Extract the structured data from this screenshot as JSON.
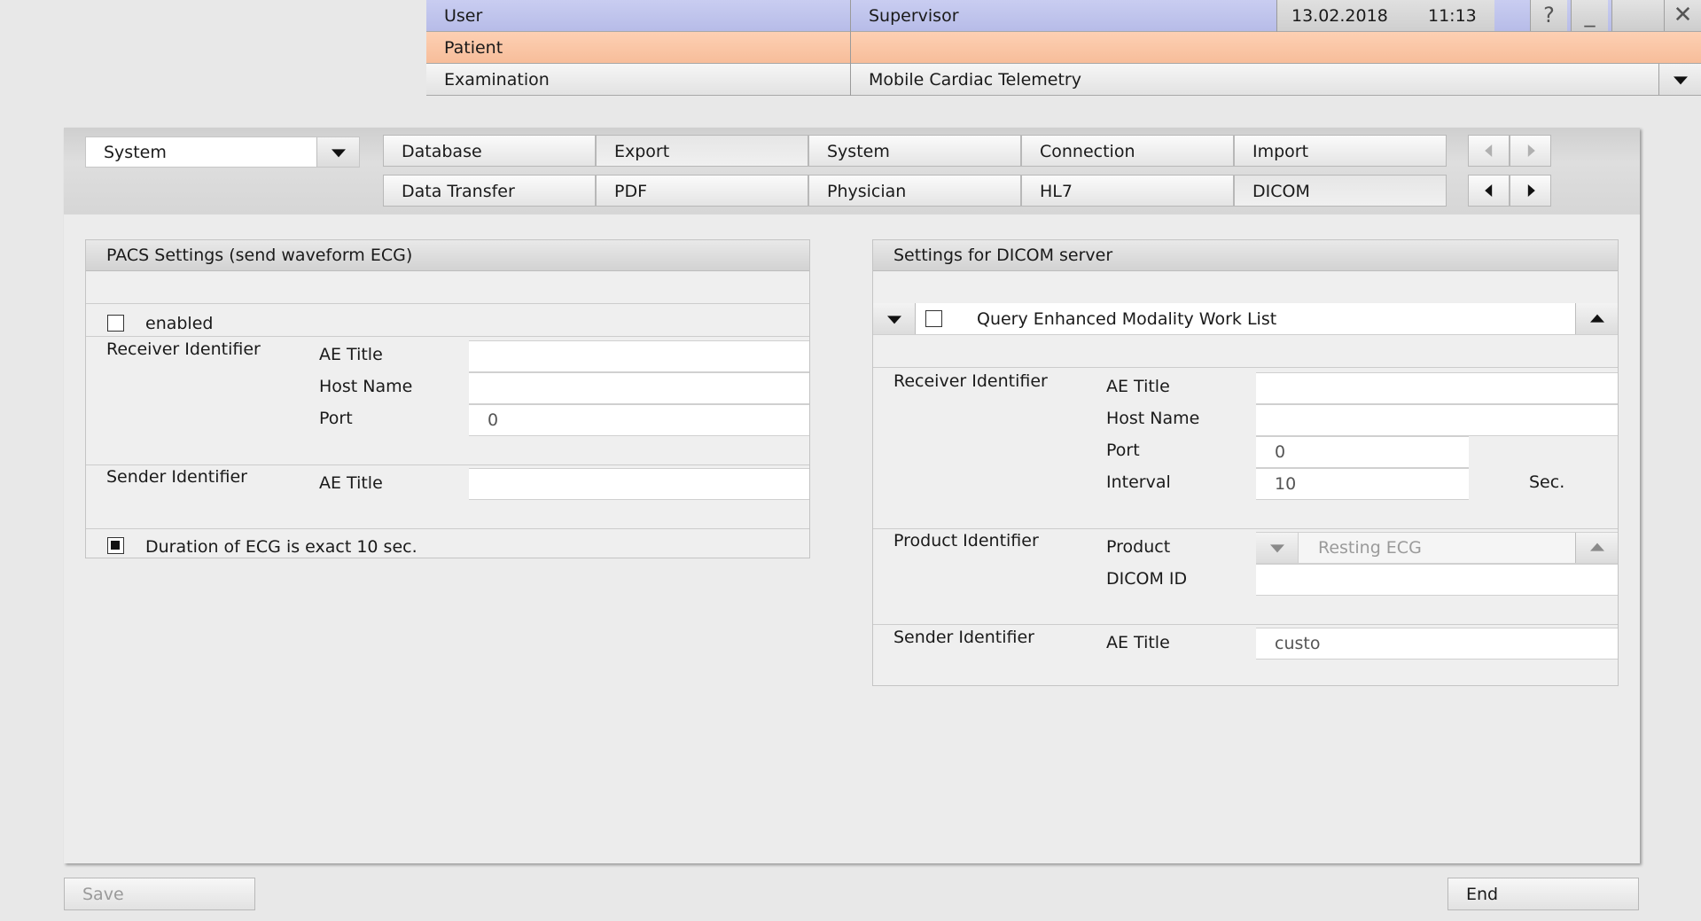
{
  "header": {
    "user_label": "User",
    "user_value": "Supervisor",
    "date": "13.02.2018",
    "time": "11:13",
    "help_glyph": "?",
    "minimize_glyph": "_",
    "close_glyph": "✕",
    "patient_label": "Patient",
    "patient_value": "",
    "exam_label": "Examination",
    "exam_value": "Mobile Cardiac Telemetry",
    "icons": [
      "help-icon",
      "minimize-icon",
      "close-icon",
      "chevron-down-icon"
    ]
  },
  "module_select": {
    "value": "System"
  },
  "tabs": {
    "row1": [
      "Database",
      "Export",
      "System",
      "Connection",
      "Import"
    ],
    "row2": [
      "Data Transfer",
      "PDF",
      "Physician",
      "HL7",
      "DICOM"
    ],
    "active_row1": "Export",
    "active_row2": "DICOM"
  },
  "pacs": {
    "title": "PACS Settings (send waveform ECG)",
    "enabled_label": "enabled",
    "enabled_checked": false,
    "receiver_label": "Receiver Identifier",
    "ae_title_label": "AE Title",
    "ae_title_value": "",
    "host_label": "Host Name",
    "host_value": "",
    "port_label": "Port",
    "port_value": "0",
    "sender_label": "Sender Identifier",
    "sender_ae_label": "AE Title",
    "sender_ae_value": "",
    "duration_label": "Duration of ECG is exact 10 sec.",
    "duration_checked": true
  },
  "dicom": {
    "title": "Settings for DICOM server",
    "query_label": "Query Enhanced Modality Work List",
    "query_checked": false,
    "receiver_label": "Receiver Identifier",
    "ae_title_label": "AE Title",
    "ae_title_value": "",
    "host_label": "Host Name",
    "host_value": "",
    "port_label": "Port",
    "port_value": "0",
    "interval_label": "Interval",
    "interval_value": "10",
    "interval_unit": "Sec.",
    "product_id_label": "Product Identifier",
    "product_label": "Product",
    "product_value": "Resting ECG",
    "dicom_id_label": "DICOM ID",
    "dicom_id_value": "",
    "sender_label": "Sender Identifier",
    "sender_ae_label": "AE Title",
    "sender_ae_value": "custo"
  },
  "footer": {
    "save_label": "Save",
    "end_label": "End"
  }
}
